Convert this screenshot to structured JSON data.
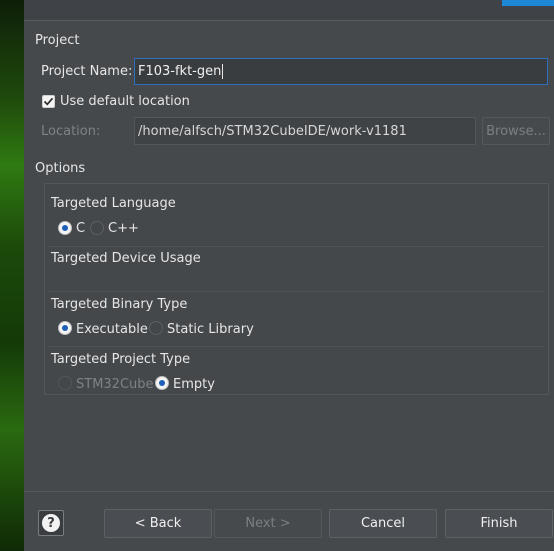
{
  "project": {
    "section_title": "Project",
    "name_label": "Project Name:",
    "name_value": "F103-fkt-gen",
    "use_default_label": "Use default location",
    "use_default_checked": true,
    "location_label": "Location:",
    "location_value": "/home/alfsch/STM32CubeIDE/work-v1181",
    "browse_label": "Browse..."
  },
  "options": {
    "section_title": "Options",
    "language": {
      "title": "Targeted Language",
      "choices": [
        "C",
        "C++"
      ],
      "selected": "C"
    },
    "device_usage": {
      "title": "Targeted Device Usage"
    },
    "binary": {
      "title": "Targeted Binary Type",
      "choices": [
        "Executable",
        "Static Library"
      ],
      "selected": "Executable"
    },
    "project_type": {
      "title": "Targeted Project Type",
      "choices": [
        "STM32Cube",
        "Empty"
      ],
      "selected": "Empty"
    }
  },
  "buttons": {
    "help_glyph": "?",
    "back": "< Back",
    "next": "Next >",
    "cancel": "Cancel",
    "finish": "Finish"
  },
  "colors": {
    "accent": "#1e88d6",
    "dialog_bg": "#46494c",
    "radio_selected": "#1f5fb8"
  }
}
